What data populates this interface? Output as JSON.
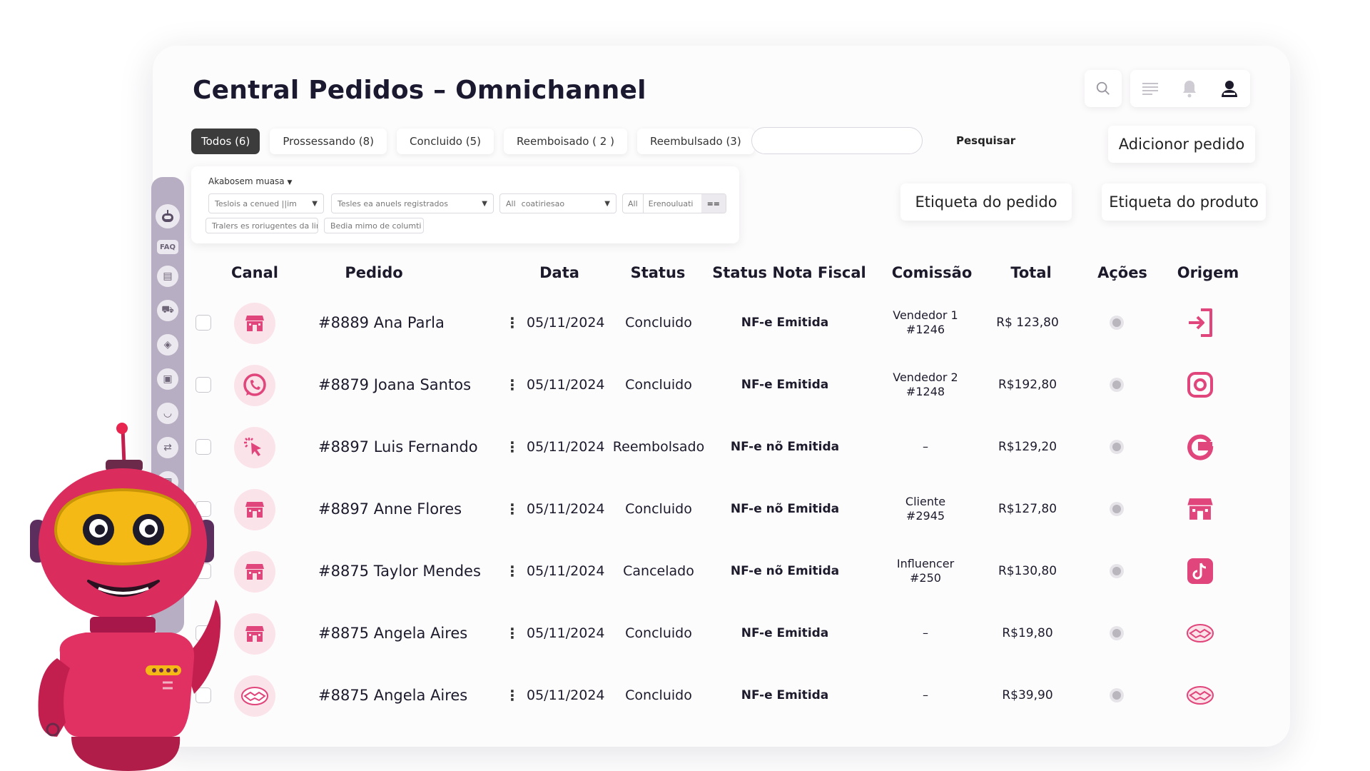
{
  "page": {
    "title": "Central Pedidos – Omnichannel"
  },
  "tabs": [
    {
      "label": "Todos (6)",
      "active": true
    },
    {
      "label": "Prossessando (8)",
      "active": false
    },
    {
      "label": "Concluido (5)",
      "active": false
    },
    {
      "label": "Reemboisado ( 2 )",
      "active": false
    },
    {
      "label": "Reembulsado (3)",
      "active": false
    }
  ],
  "search": {
    "placeholder": "",
    "button_label": "Pesquisar"
  },
  "actions": {
    "add_order": "Adicionor pedido",
    "order_label": "Etiqueta do pedido",
    "product_label": "Etiqueta do produto"
  },
  "filters": {
    "heading": "Akabosem muasa",
    "select1": "Teslois a cenued ||im",
    "select2": "Tesles ea anuels registrados",
    "select3_prefix": "All",
    "select3": "coatiriesao",
    "select4_prefix": "All",
    "select4": "Erenouluati",
    "select4_suffix": "==",
    "select5": "Tralers es roriugentes da lims",
    "select6": "Bedia mimo de columti"
  },
  "sidebar": {
    "faq_label": "FAQ",
    "icons": [
      "robot-icon",
      "faq-icon",
      "report-icon",
      "delivery-icon",
      "tag-icon",
      "box-icon",
      "basket-icon",
      "transfer-icon",
      "chart-icon"
    ]
  },
  "table": {
    "headers": {
      "canal": "Canal",
      "pedido": "Pedido",
      "data": "Data",
      "status": "Status",
      "nf": "Status Nota Fiscal",
      "comissao": "Comissão",
      "total": "Total",
      "acoes": "Ações",
      "origem": "Origem"
    },
    "rows": [
      {
        "canal_icon": "store-icon",
        "pedido": "#8889 Ana Parla",
        "data": "05/11/2024",
        "status": "Concluido",
        "nf": "NF-e Emitida",
        "comissao_1": "Vendedor 1",
        "comissao_2": "#1246",
        "total": "R$ 123,80",
        "origem_icon": "login-icon"
      },
      {
        "canal_icon": "whatsapp-icon",
        "pedido": "#8879 Joana Santos",
        "data": "05/11/2024",
        "status": "Concluido",
        "nf": "NF-e Emitida",
        "comissao_1": "Vendedor 2",
        "comissao_2": "#1248",
        "total": "R$192,80",
        "origem_icon": "instagram-icon"
      },
      {
        "canal_icon": "cursor-click-icon",
        "pedido": "#8897 Luis Fernando",
        "data": "05/11/2024",
        "status": "Reembolsado",
        "nf": "NF-e nõ Emitida",
        "comissao_1": "–",
        "comissao_2": "",
        "total": "R$129,20",
        "origem_icon": "google-icon"
      },
      {
        "canal_icon": "store-icon",
        "pedido": "#8897 Anne Flores",
        "data": "05/11/2024",
        "status": "Concluido",
        "nf": "NF-e nõ Emitida",
        "comissao_1": "Cliente",
        "comissao_2": "#2945",
        "total": "R$127,80",
        "origem_icon": "store-icon"
      },
      {
        "canal_icon": "store-icon",
        "pedido": "#8875 Taylor Mendes",
        "data": "05/11/2024",
        "status": "Cancelado",
        "nf": "NF-e nõ Emitida",
        "comissao_1": "Influencer",
        "comissao_2": "#250",
        "total": "R$130,80",
        "origem_icon": "tiktok-icon"
      },
      {
        "canal_icon": "store-icon",
        "pedido": "#8875 Angela Aires",
        "data": "05/11/2024",
        "status": "Concluido",
        "nf": "NF-e Emitida",
        "comissao_1": "–",
        "comissao_2": "",
        "total": "R$19,80",
        "origem_icon": "handshake-icon"
      },
      {
        "canal_icon": "handshake-icon",
        "pedido": "#8875 Angela Aires",
        "data": "05/11/2024",
        "status": "Concluido",
        "nf": "NF-e Emitida",
        "comissao_1": "–",
        "comissao_2": "",
        "total": "R$39,90",
        "origem_icon": "handshake-icon"
      }
    ]
  },
  "colors": {
    "accent": "#e0457b",
    "accent_light": "#fbe3ea",
    "active_tab": "#3c3c3c",
    "robot_body": "#d92b5c",
    "robot_visor": "#f2b70f"
  }
}
